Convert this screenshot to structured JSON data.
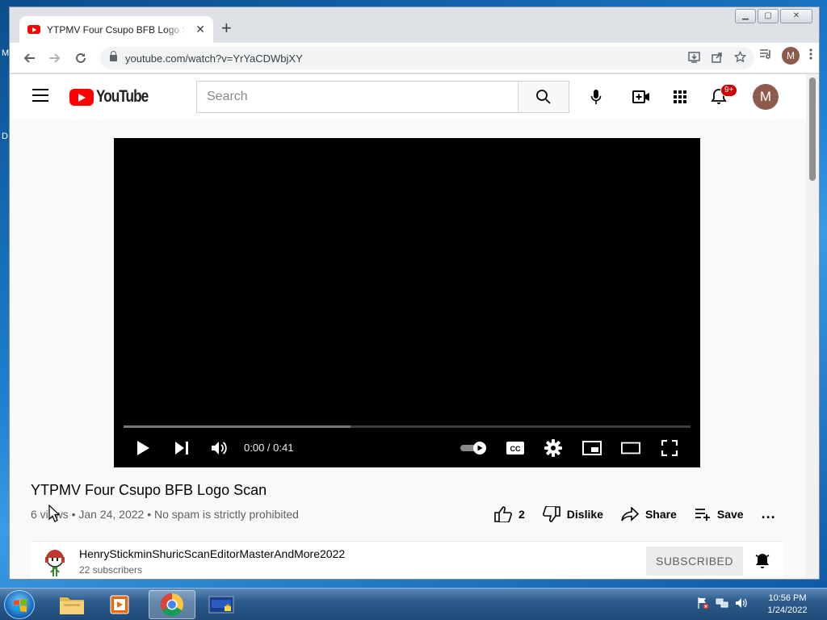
{
  "browser": {
    "tab_title": "YTPMV Four Csupo BFB Logo Scan - YouTube",
    "url": "youtube.com/watch?v=YrYaCDWbjXY",
    "profile_initial": "M"
  },
  "youtube": {
    "logo_text": "YouTube",
    "search_placeholder": "Search",
    "notification_badge": "9+",
    "avatar_initial": "M",
    "player": {
      "time": "0:00 / 0:41",
      "progress_loaded_fraction": 0.4
    },
    "video": {
      "title": "YTPMV Four Csupo BFB Logo Scan",
      "info": "6 views • Jan 24, 2022 • No spam is strictly prohibited",
      "like_count": "2",
      "dislike_label": "Dislike",
      "share_label": "Share",
      "save_label": "Save",
      "more_label": "..."
    },
    "channel": {
      "name": "HenryStickminShuricScanEditorMasterAndMore2022",
      "subscribers": "22 subscribers",
      "subscribe_label": "SUBSCRIBED"
    }
  },
  "desktop": {
    "edge_text_1": "M",
    "edge_text_2": "D"
  },
  "taskbar": {
    "time": "10:56 PM",
    "date": "1/24/2022"
  },
  "colors": {
    "brand_red": "#ff0000",
    "badge_red": "#cc0000",
    "avatar_brown": "#8d5b4c"
  }
}
